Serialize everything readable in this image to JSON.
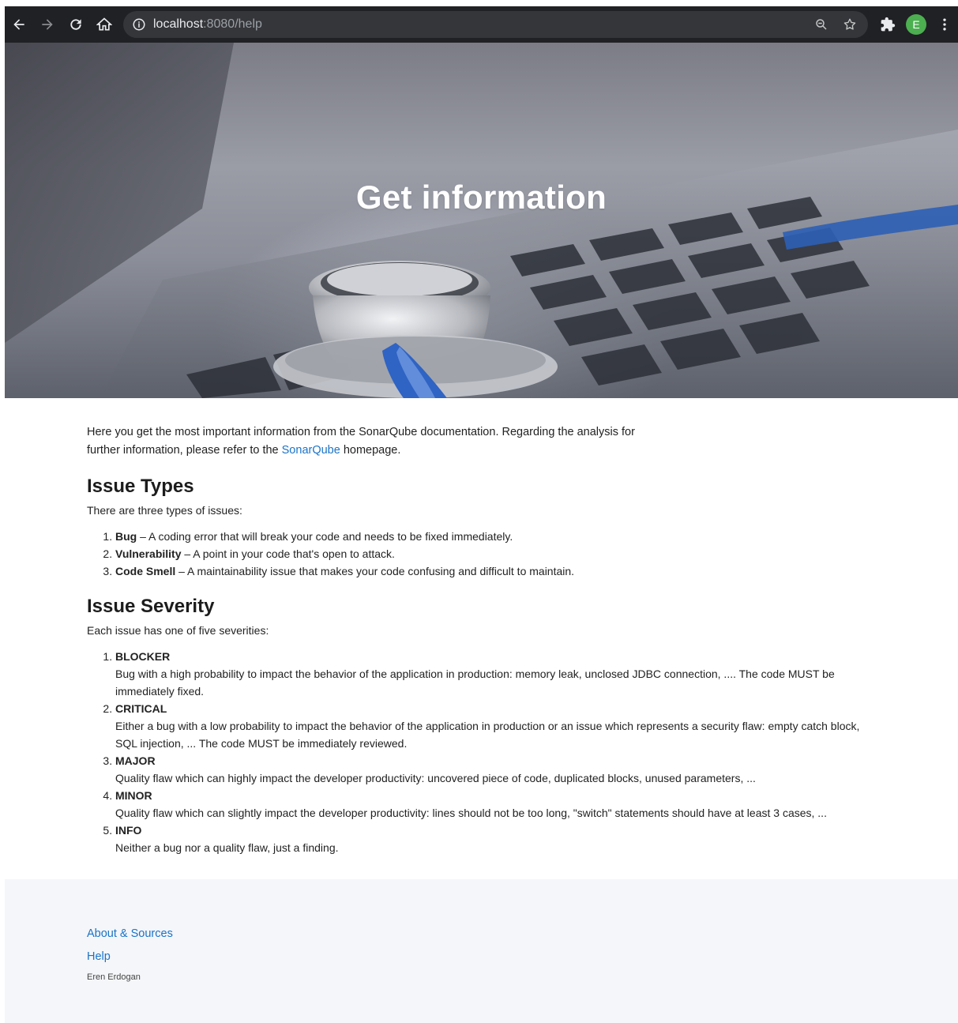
{
  "browser": {
    "url_host": "localhost",
    "url_rest": ":8080/help",
    "avatar_letter": "E",
    "avatar_color": "#4caf50"
  },
  "hero": {
    "title": "Get information"
  },
  "intro": {
    "text_before": "Here you get the most important information from the SonarQube documentation. Regarding the analysis for further information, please refer to the ",
    "link_text": "SonarQube",
    "text_after": " homepage."
  },
  "issue_types": {
    "heading": "Issue Types",
    "lead": "There are three types of issues:",
    "items": [
      {
        "name": "Bug",
        "desc": " – A coding error that will break your code and needs to be fixed immediately."
      },
      {
        "name": "Vulnerability",
        "desc": " – A point in your code that's open to attack."
      },
      {
        "name": "Code Smell",
        "desc": " – A maintainability issue that makes your code confusing and difficult to maintain."
      }
    ]
  },
  "issue_severity": {
    "heading": "Issue Severity",
    "lead": "Each issue has one of five severities:",
    "items": [
      {
        "name": "BLOCKER",
        "desc": "Bug with a high probability to impact the behavior of the application in production: memory leak, unclosed JDBC connection, .... The code MUST be immediately fixed."
      },
      {
        "name": "CRITICAL",
        "desc": "Either a bug with a low probability to impact the behavior of the application in production or an issue which represents a security flaw: empty catch block, SQL injection, ... The code MUST be immediately reviewed."
      },
      {
        "name": "MAJOR",
        "desc": "Quality flaw which can highly impact the developer productivity: uncovered piece of code, duplicated blocks, unused parameters, ..."
      },
      {
        "name": "MINOR",
        "desc": "Quality flaw which can slightly impact the developer productivity: lines should not be too long, \"switch\" statements should have at least 3 cases, ..."
      },
      {
        "name": "INFO",
        "desc": "Neither a bug nor a quality flaw, just a finding."
      }
    ]
  },
  "footer": {
    "about_label": "About & Sources",
    "help_label": "Help",
    "author": "Eren Erdogan"
  },
  "colors": {
    "link": "#1a73c8",
    "chrome_bg": "#202124",
    "footer_bg": "#f4f6f9"
  }
}
